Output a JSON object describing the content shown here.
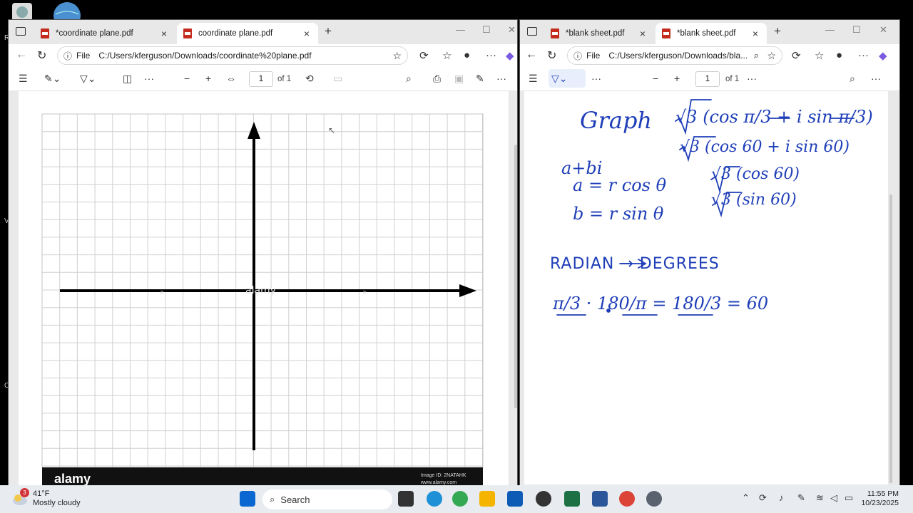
{
  "left_window": {
    "tabs": [
      {
        "label": "*coordinate plane.pdf",
        "active": false
      },
      {
        "label": "coordinate plane.pdf",
        "active": true
      }
    ],
    "address": {
      "file_label": "File",
      "url": "C:/Users/kferguson/Downloads/coordinate%20plane.pdf"
    },
    "page_input": "1",
    "page_total": "of 1",
    "footer": {
      "brand": "alamy",
      "image_id": "Image ID: 2NATAHK",
      "site": "www.alamy.com"
    }
  },
  "right_window": {
    "tabs": [
      {
        "label": "*blank sheet.pdf",
        "active": false
      },
      {
        "label": "*blank sheet.pdf",
        "active": true
      }
    ],
    "address": {
      "file_label": "File",
      "url": "C:/Users/kferguson/Downloads/bla..."
    },
    "page_input": "1",
    "page_total": "of 1",
    "notes": {
      "line1_graph": "Graph",
      "line1_expr": "√3 (cos π/3 + i sin π/3)",
      "line2": "√3 (cos 60 + i sin 60)",
      "abi": "a+bi",
      "a_eq": "a = r cos θ",
      "b_eq": "b = r sin θ",
      "a_val": "√3 (cos 60)",
      "b_val": "√3 (sin 60)",
      "radian_label": "RADIAN → DEGREES",
      "conversion": "π/3 · 180/π = 180/3 = 60"
    }
  },
  "desktop_edge_chars": [
    "R",
    "V",
    "C"
  ],
  "taskbar": {
    "weather_badge": "3",
    "temperature": "41°F",
    "condition": "Mostly cloudy",
    "search_placeholder": "Search",
    "time": "11:55 PM",
    "date": "10/23/2025"
  },
  "colors": {
    "ink": "#1f3fb8",
    "taskbar": "#e8ecf1",
    "pdf_red": "#c42b1c",
    "grid_line": "#d0d0d0"
  }
}
